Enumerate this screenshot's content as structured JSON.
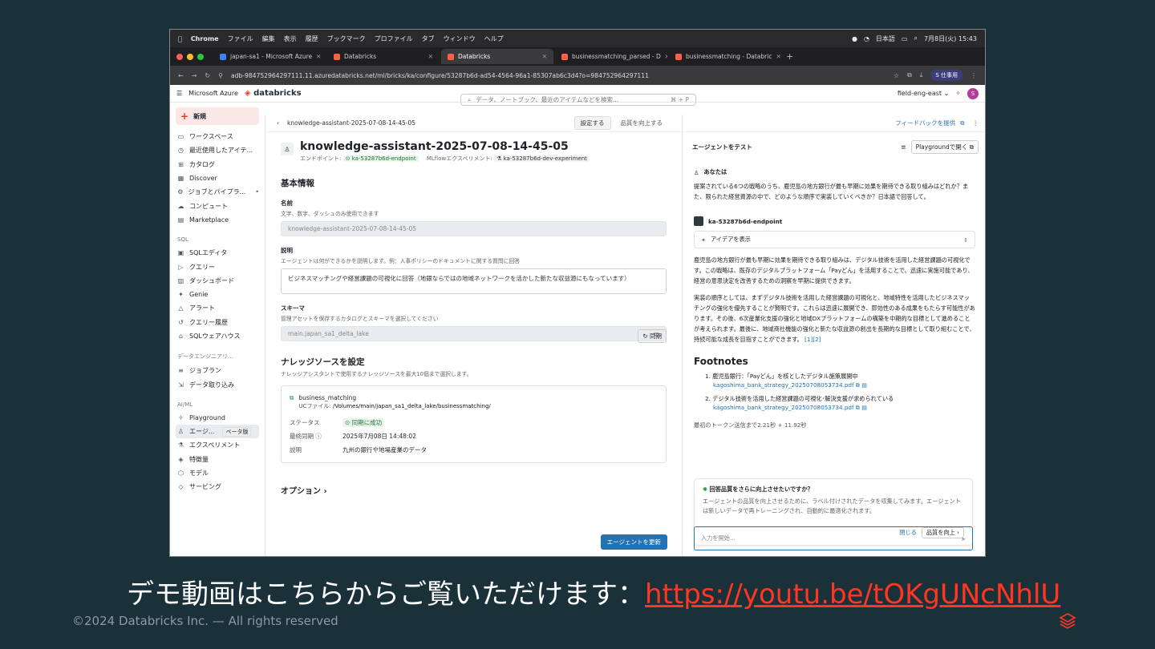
{
  "menubar": {
    "app": "Chrome",
    "items": [
      "ファイル",
      "編集",
      "表示",
      "履歴",
      "ブックマーク",
      "プロファイル",
      "タブ",
      "ウィンドウ",
      "ヘルプ"
    ],
    "lang": "日本語",
    "clock": "7月8日(火) 15:43"
  },
  "tabs": [
    {
      "label": "japan-sa1 - Microsoft Azure"
    },
    {
      "label": "Databricks"
    },
    {
      "label": "Databricks"
    },
    {
      "label": "businessmatching_parsed - D"
    },
    {
      "label": "businessmatching - Databric"
    }
  ],
  "address": {
    "url": "adb-984752964297111.11.azuredatabricks.net/ml/bricks/ka/configure/53287b6d-ad54-4564-96a1-85307ab6c3d4?o=984752964297111",
    "profile": "仕事用",
    "profile_initial": "S"
  },
  "header": {
    "azure": "Microsoft Azure",
    "brand": "databricks",
    "search_placeholder": "データ、ノートブック、最近のアイテムなどを検索...",
    "search_kbd": "⌘ + P",
    "workspace": "field-eng-east ⌄",
    "avatar": "S"
  },
  "sidebar": {
    "new": "新規",
    "top": [
      {
        "icon": "▭",
        "label": "ワークスペース"
      },
      {
        "icon": "◷",
        "label": "最近使用したアイテ..."
      },
      {
        "icon": "⊞",
        "label": "カタログ"
      },
      {
        "icon": "▦",
        "label": "Discover"
      },
      {
        "icon": "⚙",
        "label": "ジョブとパイプラ..."
      },
      {
        "icon": "☁",
        "label": "コンピュート"
      },
      {
        "icon": "▤",
        "label": "Marketplace"
      }
    ],
    "sql_title": "SQL",
    "sql": [
      {
        "icon": "▣",
        "label": "SQLエディタ"
      },
      {
        "icon": "▷",
        "label": "クエリー"
      },
      {
        "icon": "▥",
        "label": "ダッシュボード"
      },
      {
        "icon": "✦",
        "label": "Genie"
      },
      {
        "icon": "△",
        "label": "アラート"
      },
      {
        "icon": "↺",
        "label": "クエリー履歴"
      },
      {
        "icon": "⌂",
        "label": "SQLウェアハウス"
      }
    ],
    "de_title": "データエンジニアリ...",
    "de": [
      {
        "icon": "≡",
        "label": "ジョブラン"
      },
      {
        "icon": "⇲",
        "label": "データ取り込み"
      }
    ],
    "ai_title": "AI/ML",
    "ai": [
      {
        "icon": "✧",
        "label": "Playground"
      },
      {
        "icon": "♙",
        "label": "エージ...",
        "badge": "ベータ版"
      },
      {
        "icon": "⚗",
        "label": "エクスペリメント"
      },
      {
        "icon": "◈",
        "label": "特徴量"
      },
      {
        "icon": "⬡",
        "label": "モデル"
      },
      {
        "icon": "◇",
        "label": "サービング"
      }
    ]
  },
  "main": {
    "crumb": "knowledge-assistant-2025-07-08-14-45-05",
    "configure": "設定する",
    "improve": "品質を向上する",
    "title": "knowledge-assistant-2025-07-08-14-45-05",
    "endpoint_label": "エンドポイント:",
    "endpoint": "ka-53287b6d-endpoint",
    "mlflow_label": "MLflowエクスペリメント:",
    "experiment": "ka-53287b6d-dev-experiment",
    "basic": "基本情報",
    "name_label": "名前",
    "name_hint": "文字、数字、ダッシュのみ使用できます",
    "name_value": "knowledge-assistant-2025-07-08-14-45-05",
    "desc_label": "説明",
    "desc_hint": "エージェントは何ができるかを説明します。例：人事ポリシーのドキュメントに関する質問に回答",
    "desc_value": "ビジネスマッチングや経営課題の可視化に回答（地銀ならではの地域ネットワークを活かした新たな収益源にもなっています）",
    "schema_label": "スキーマ",
    "schema_hint": "管理アセットを保存するカタログとスキーマを選択してください",
    "schema_value": "main.japan_sa1_delta_lake",
    "ks_title": "ナレッジソースを設定",
    "ks_hint": "ナレッジアシスタントで使用するナレッジソースを最大10個まで選択します。",
    "sync": "同期",
    "ks": {
      "name": "business_matching",
      "uc_label": "UCファイル:",
      "uc_path": "/Volumes/main/japan_sa1_delta_lake/businessmatching/",
      "status_k": "ステータス",
      "status_v": "同期に成功",
      "last_k": "最終同期",
      "last_v": "2025年7月08日 14:48:02",
      "desc_k": "説明",
      "desc_v": "九州の銀行や地場産業のデータ"
    },
    "options": "オプション",
    "update": "エージェントを更新"
  },
  "panel": {
    "feedback": "フィードバックを提供",
    "test_title": "エージェントをテスト",
    "playground": "Playgroundで開く",
    "you": "あなたは",
    "question": "提案されている6つの戦略のうち、鹿児島の地方銀行が最も早期に効果を期待できる取り組みはどれか？また、限られた経営資源の中で、どのような順序で実装していくべきか？日本語で回答して。",
    "endpoint": "ka-53287b6d-endpoint",
    "idea": "アイデアを表示",
    "answer1": "鹿児島の地方銀行が最も早期に効果を期待できる取り組みは、デジタル技術を活用した経営課題の可視化です。この戦略は、既存のデジタルプラットフォーム「Payどん」を活用することで、迅速に実施可能であり、経営の意思決定を改善するための洞察を早期に提供できます。",
    "answer2": "実装の順序としては、まずデジタル技術を活用した経営課題の可視化と、地域特性を活用したビジネスマッチングの強化を優先することが賢明です。これらは迅速に展開でき、即効性のある成果をもたらす可能性があります。その後、6次産業化支援の強化と地域DXプラットフォームの構築を中期的な目標として進めることが考えられます。最後に、地域商社機能の強化と新たな収益源の創出を長期的な目標として取り組むことで、持続可能な成長を目指すことができます。",
    "refs": "[1][2]",
    "footnotes": "Footnotes",
    "fn1": "1. 鹿児島銀行：「Payどん」を核としたデジタル施策展開中",
    "fn1_link": "kagoshima_bank_strategy_20250708053734.pdf",
    "fn2": "2. デジタル技術を活用した経営課題の可視化･解決支援が求められている",
    "fn2_link": "kagoshima_bank_strategy_20250708053734.pdf",
    "timing": "最初のトークン送信まで2.21秒 + 11.92秒",
    "card_q": "回答品質をさらに向上させたいですか？",
    "card_d": "エージェントの品質を向上させるために、ラベル付けされたデータを収集してみます。エージェントは新しいデータで再トレーニングされ、自動的に最適化されます。",
    "close": "閉じる",
    "improve": "品質を向上",
    "input_placeholder": "入力を開始..."
  },
  "slide": {
    "caption": "デモ動画はこちらからご覧いただけます：",
    "link": "https://youtu.be/tOKgUNcNhlU",
    "copyright": "©2024 Databricks Inc. — All rights reserved"
  },
  "colors": {
    "background": "#1b3139",
    "accent": "#ff3621",
    "link": "#2272b4",
    "success": "#1f7a35"
  }
}
